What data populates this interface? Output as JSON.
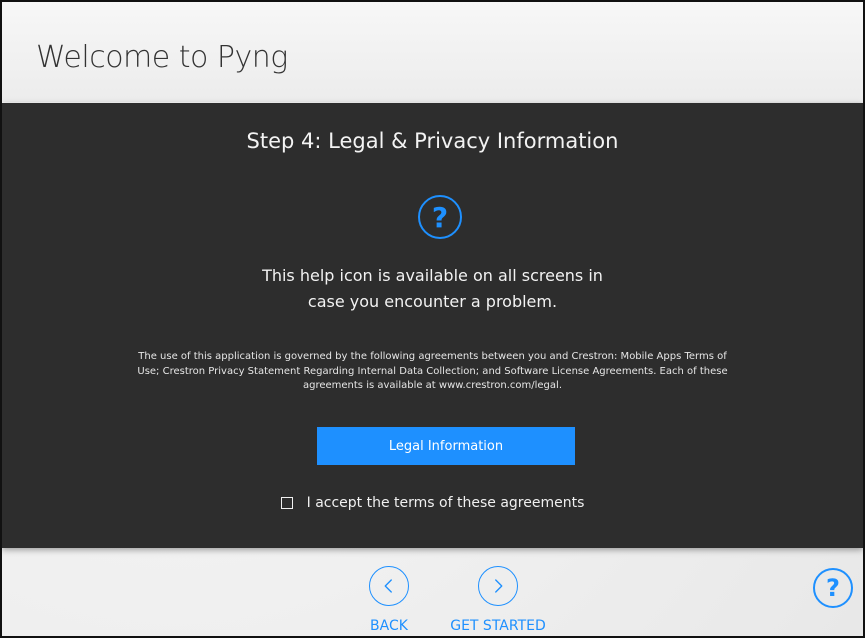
{
  "header": {
    "title": "Welcome to Pyng"
  },
  "panel": {
    "step_title": "Step 4: Legal & Privacy Information",
    "help_icon": "?",
    "help_text": "This help icon is available on all screens in\ncase you encounter a problem.",
    "legal_text": "The use of this application is governed by the following agreements between you and Crestron: Mobile Apps Terms of Use; Crestron Privacy Statement Regarding Internal Data Collection; and Software License Agreements. Each of these agreements is available at www.crestron.com/legal.",
    "legal_button_label": "Legal Information",
    "accept_label": "I accept the terms of these agreements"
  },
  "nav": {
    "back_label": "BACK",
    "next_label": "GET STARTED",
    "help_icon": "?"
  },
  "colors": {
    "accent": "#1e90ff",
    "panel_bg": "#2d2d2d"
  },
  "icons": {
    "back": "chevron-left-icon",
    "next": "chevron-right-icon",
    "help": "help-icon"
  }
}
